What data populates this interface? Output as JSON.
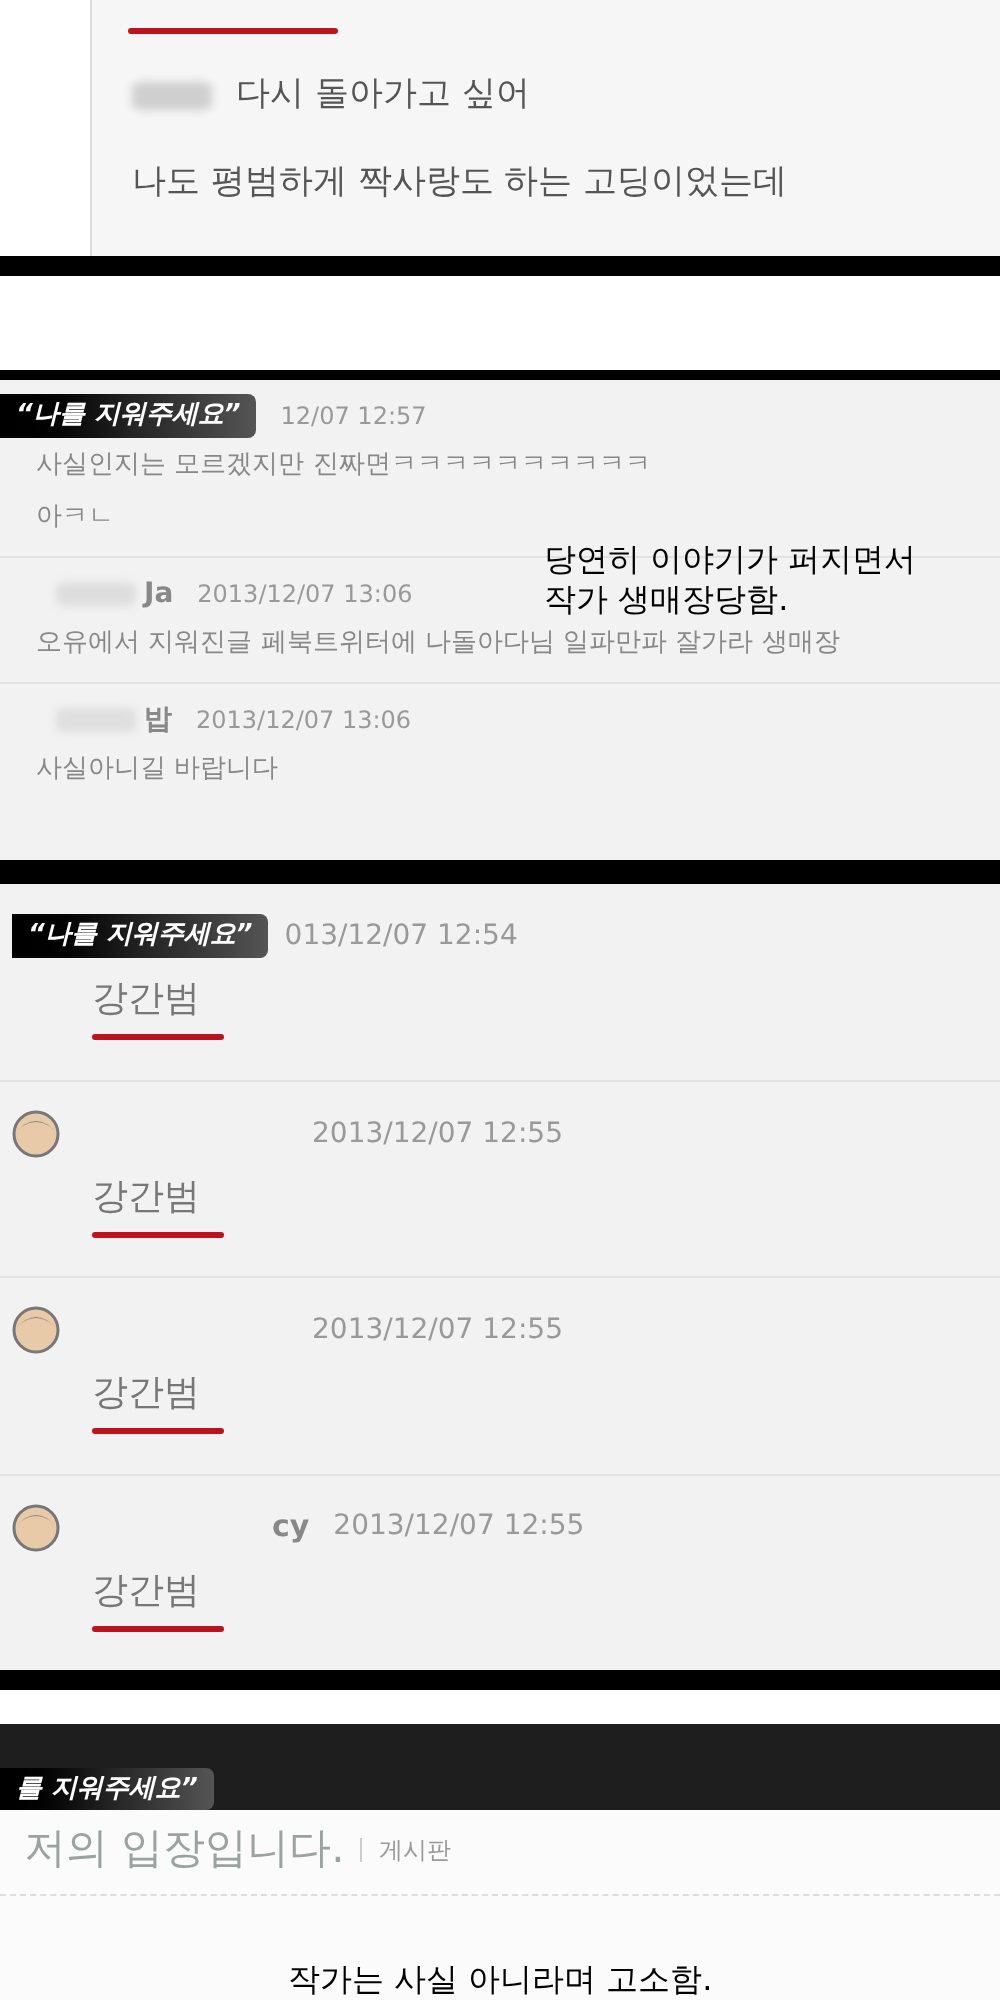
{
  "panels": [
    {
      "kind": "post",
      "lines": [
        {
          "kind": "underline"
        },
        {
          "kind": "text",
          "text": "다시 돌아가고 싶어",
          "blurred_name": true
        },
        {
          "kind": "text",
          "text": "나도 평범하게 짝사랑도 하는 고딩이었는데"
        }
      ]
    },
    {
      "kind": "comments",
      "badge": "“나를 지워주세요”",
      "caption": [
        "당연히 이야기가 퍼지면서",
        "작가 생매장당함."
      ],
      "comments": [
        {
          "time": "12/07 12:57",
          "lines": [
            "사실인지는 모르겠지만 진짜면ㅋㅋㅋㅋㅋㅋㅋㅋㅋㅋ",
            "아ㅋㄴ"
          ]
        },
        {
          "name": "Ja",
          "time": "2013/12/07 13:06",
          "lines": [
            "오유에서 지워진글 페북트위터에 나돌아다님 일파만파 잘가라 생매장"
          ]
        },
        {
          "name": "밥",
          "time": "2013/12/07 13:06",
          "lines": [
            "사실아니길 바랍니다"
          ]
        }
      ]
    },
    {
      "kind": "replies",
      "badge": "“나를 지워주세요”",
      "replies": [
        {
          "time": "013/12/07 12:54",
          "text": "강간범"
        },
        {
          "time": "2013/12/07 12:55",
          "text": "강간범"
        },
        {
          "time": "2013/12/07 12:55",
          "text": "강간범"
        },
        {
          "name": "cy",
          "time": "2013/12/07 12:55",
          "text": "강간범"
        }
      ]
    },
    {
      "kind": "notice",
      "badge": "를 지워주세요”",
      "title": "저의 입장입니다.",
      "board": "게시판",
      "caption": "작가는 사실 아니라며 고소함."
    }
  ]
}
